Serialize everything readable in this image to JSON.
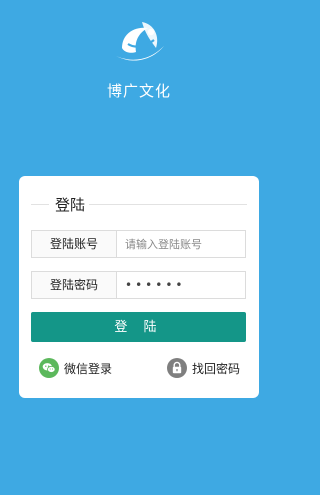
{
  "app": {
    "brand_name": "博广文化",
    "background_color": "#3ea9e3",
    "logo_icon": "leaf-swoosh-logo"
  },
  "login_card": {
    "legend": "登陆",
    "account": {
      "label": "登陆账号",
      "placeholder": "请输入登陆账号",
      "value": ""
    },
    "password": {
      "label": "登陆密码",
      "value": "******"
    },
    "submit_label": "登 陆",
    "submit_color": "#149688",
    "wechat_login": {
      "label": "微信登录",
      "icon": "wechat-icon",
      "color": "#5cb85c"
    },
    "recover_password": {
      "label": "找回密码",
      "icon": "lock-icon",
      "color": "#7f7f7f"
    }
  }
}
